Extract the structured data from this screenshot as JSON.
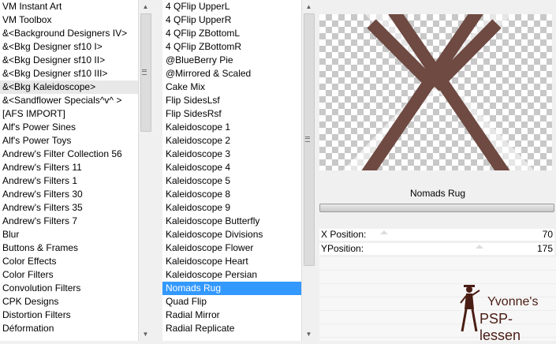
{
  "categories": {
    "items": [
      "VM Instant Art",
      "VM Toolbox",
      "&<Background Designers IV>",
      "&<Bkg Designer sf10 I>",
      "&<Bkg Designer sf10 II>",
      "&<Bkg Designer sf10 III>",
      "&<Bkg Kaleidoscope>",
      "&<Sandflower Specials^v^ >",
      "[AFS IMPORT]",
      "Alf's Power Sines",
      "Alf's Power Toys",
      "Andrew's Filter Collection 56",
      "Andrew's Filters 11",
      "Andrew's Filters 1",
      "Andrew's Filters 30",
      "Andrew's Filters 35",
      "Andrew's Filters 7",
      "Blur",
      "Buttons & Frames",
      "Color Effects",
      "Color Filters",
      "Convolution Filters",
      "CPK Designs",
      "Distortion Filters",
      "Déformation"
    ],
    "hover_index": 6
  },
  "filters": {
    "items": [
      "4 QFlip UpperL",
      "4 QFlip UpperR",
      "4 QFlip ZBottomL",
      "4 QFlip ZBottomR",
      "@BlueBerry Pie",
      "@Mirrored & Scaled",
      "Cake Mix",
      "Flip SidesLsf",
      "Flip SidesRsf",
      "Kaleidoscope 1",
      "Kaleidoscope 2",
      "Kaleidoscope 3",
      "Kaleidoscope 4",
      "Kaleidoscope 5",
      "Kaleidoscope 8",
      "Kaleidoscope 9",
      "Kaleidoscope Butterfly",
      "Kaleidoscope Divisions",
      "Kaleidoscope Flower",
      "Kaleidoscope Heart",
      "Kaleidoscope Persian",
      "Nomads Rug",
      "Quad Flip",
      "Radial Mirror",
      "Radial Replicate"
    ],
    "selected_index": 21
  },
  "selected_filter_name": "Nomads Rug",
  "params": {
    "x": {
      "label": "X Position:",
      "value": "70"
    },
    "y": {
      "label": "YPosition:",
      "value": "175"
    }
  },
  "logo": {
    "line1": "Yvonne's",
    "line2": "PSP-lessen"
  },
  "icons": {
    "up": "▲",
    "down": "▼"
  },
  "colors": {
    "selection": "#3399ff",
    "stripe_brown": "#6e4a42",
    "logo_brown": "#4a1d14"
  }
}
